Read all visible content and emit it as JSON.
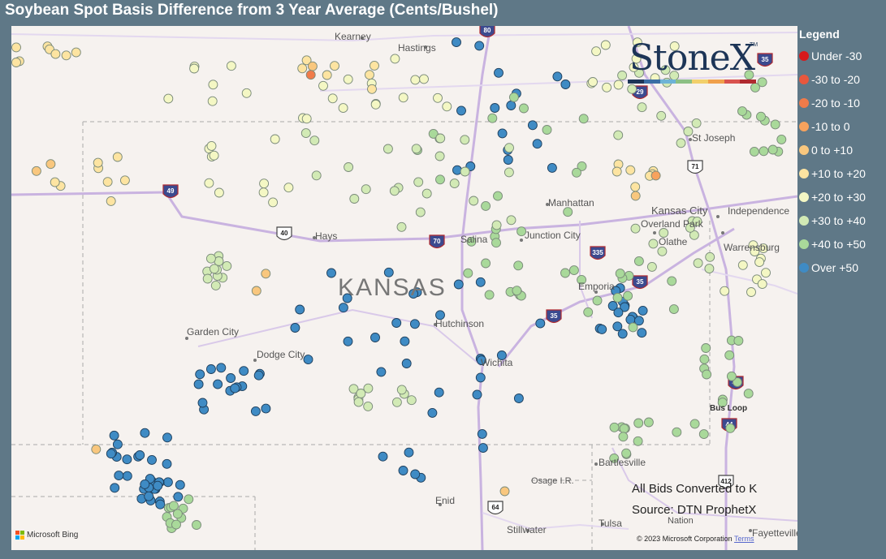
{
  "title": "Soybean Spot Basis Difference from 3 Year Average (Cents/Bushel)",
  "logo": {
    "text": "StoneX",
    "tm": "TM",
    "bar_colors": [
      "#1d3557",
      "#3a6ea5",
      "#6db3d6",
      "#8cc084",
      "#f2d06b",
      "#f0a04b",
      "#d9534f",
      "#b02a30"
    ]
  },
  "legend": {
    "title": "Legend",
    "items": [
      {
        "label": "Under -30",
        "color": "#d7191c"
      },
      {
        "label": "-30 to -20",
        "color": "#e8573d"
      },
      {
        "label": "-20 to -10",
        "color": "#f07b4a"
      },
      {
        "label": "-10 to 0",
        "color": "#f7a25d"
      },
      {
        "label": "0 to +10",
        "color": "#f9c77e"
      },
      {
        "label": "+10 to +20",
        "color": "#fde4a1"
      },
      {
        "label": "+20 to +30",
        "color": "#f4f7c4"
      },
      {
        "label": "+30 to +40",
        "color": "#d2eab5"
      },
      {
        "label": "+40 to +50",
        "color": "#a9d99a"
      },
      {
        "label": "Over +50",
        "color": "#3f8bc4"
      }
    ]
  },
  "places": {
    "kearney": "Kearney",
    "hastings": "Hastings",
    "st_joseph": "St Joseph",
    "manhattan": "Manhattan",
    "kansas_city": "Kansas City",
    "independence": "Independence",
    "overland_park": "Overland Park",
    "olathe": "Olathe",
    "warrensburg": "Warrensburg",
    "hays": "Hays",
    "salina": "Salina",
    "junction_city": "Junction City",
    "emporia": "Emporia",
    "kansas": "KANSAS",
    "hutchinson": "Hutchinson",
    "wichita": "Wichita",
    "garden_city": "Garden City",
    "dodge_city": "Dodge City",
    "bartlesville": "Bartlesville",
    "osage": "Osage I.R.",
    "enid": "Enid",
    "stillwater": "Stillwater",
    "tulsa": "Tulsa",
    "fayetteville": "Fayetteville",
    "nation": "Nation",
    "bus_loop": "Bus Loop"
  },
  "shields": [
    "80",
    "29",
    "71",
    "35",
    "70",
    "40",
    "335",
    "35",
    "35",
    "49",
    "49",
    "44",
    "412",
    "64"
  ],
  "note": {
    "line1": "All Bids Converted to K",
    "line2": "Source: DTN ProphetX"
  },
  "bing": "Microsoft Bing",
  "copyright": "© 2023 Microsoft Corporation",
  "terms": "Terms",
  "points": [
    {
      "cls": "Over +50",
      "n": 120
    },
    {
      "cls": "+40 to +50",
      "n": 95
    },
    {
      "cls": "+30 to +40",
      "n": 70
    },
    {
      "cls": "+20 to +30",
      "n": 55
    },
    {
      "cls": "+10 to +20",
      "n": 30
    },
    {
      "cls": "0 to +10",
      "n": 8
    },
    {
      "cls": "-10 to 0",
      "n": 1
    },
    {
      "cls": "-20 to -10",
      "n": 1
    }
  ]
}
